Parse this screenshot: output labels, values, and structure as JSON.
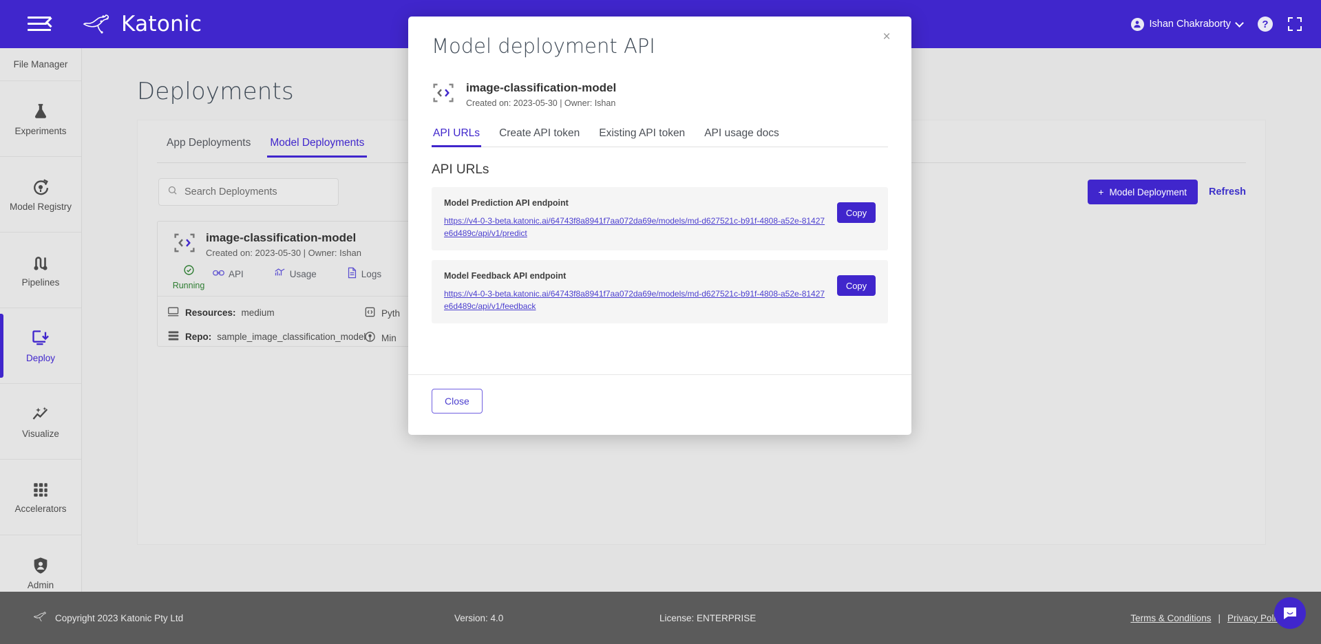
{
  "topbar": {
    "menu_icon": "hamburger-collapse-icon",
    "brand": "Katonic",
    "user_name": "Ishan Chakraborty",
    "help_label": "?",
    "icons": [
      "user-avatar-icon",
      "chevron-down-icon",
      "help-circle-icon",
      "fullscreen-icon"
    ]
  },
  "sidebar": {
    "items": [
      {
        "label": "File Manager",
        "icon": "file-manager-icon",
        "active": false
      },
      {
        "label": "Experiments",
        "icon": "flask-icon",
        "active": false
      },
      {
        "label": "Model Registry",
        "icon": "model-registry-icon",
        "active": false
      },
      {
        "label": "Pipelines",
        "icon": "pipelines-icon",
        "active": false
      },
      {
        "label": "Deploy",
        "icon": "deploy-icon",
        "active": true
      },
      {
        "label": "Visualize",
        "icon": "visualize-sparkle-icon",
        "active": false
      },
      {
        "label": "Accelerators",
        "icon": "grid-dots-icon",
        "active": false
      },
      {
        "label": "Admin",
        "icon": "admin-shield-icon",
        "active": false
      }
    ]
  },
  "main": {
    "page_title": "Deployments",
    "tabs": [
      {
        "label": "App Deployments",
        "active": false
      },
      {
        "label": "Model Deployments",
        "active": true
      }
    ],
    "search": {
      "placeholder": "Search Deployments",
      "value": "",
      "icon": "search-icon"
    },
    "actions": {
      "new_deployment_label": "Model Deployment",
      "new_deployment_plus": "+",
      "refresh_label": "Refresh"
    },
    "card": {
      "title": "image-classification-model",
      "subtitle": "Created on: 2023-05-30 | Owner: Ishan",
      "status": "Running",
      "status_color": "#2e7d32",
      "actions": [
        {
          "label": "API",
          "icon": "link-api-icon"
        },
        {
          "label": "Usage",
          "icon": "usage-chart-icon"
        },
        {
          "label": "Logs",
          "icon": "logs-document-icon"
        }
      ],
      "rows": [
        {
          "key": "Resources:",
          "value": "medium",
          "icon": "monitor-icon"
        },
        {
          "key": "Repo:",
          "value": "sample_image_classification_model",
          "icon": "repo-server-icon"
        }
      ],
      "rows_right": [
        {
          "value": "Pyth",
          "icon": "code-brackets-icon"
        },
        {
          "value": "Min",
          "icon": "broadcast-icon"
        }
      ]
    }
  },
  "modal": {
    "title": "Model deployment API",
    "close_icon": "close-icon",
    "close_glyph": "×",
    "model": {
      "icon": "code-brackets-icon",
      "name": "image-classification-model",
      "meta": "Created on: 2023-05-30 | Owner: Ishan"
    },
    "tabs": [
      {
        "label": "API URLs",
        "active": true
      },
      {
        "label": "Create API token",
        "active": false
      },
      {
        "label": "Existing API token",
        "active": false
      },
      {
        "label": "API usage docs",
        "active": false
      }
    ],
    "section_title": "API URLs",
    "endpoints": [
      {
        "label": "Model Prediction API endpoint",
        "url": "https://v4-0-3-beta.katonic.ai/64743f8a8941f7aa072da69e/models/md-d627521c-b91f-4808-a52e-81427e6d489c/api/v1/predict",
        "copy_label": "Copy"
      },
      {
        "label": "Model Feedback API endpoint",
        "url": "https://v4-0-3-beta.katonic.ai/64743f8a8941f7aa072da69e/models/md-d627521c-b91f-4808-a52e-81427e6d489c/api/v1/feedback",
        "copy_label": "Copy"
      }
    ],
    "close_button_label": "Close"
  },
  "footer": {
    "copyright": "Copyright 2023 Katonic Pty Ltd",
    "version": "Version: 4.0",
    "license": "License: ENTERPRISE",
    "terms": "Terms & Conditions",
    "separator": "|",
    "privacy": "Privacy Policy"
  },
  "chat": {
    "icon": "chat-bubble-icon"
  },
  "colors": {
    "brand_purple": "#4026cc",
    "link_purple": "#4b3ecf",
    "status_green": "#2e7d32",
    "page_bg": "#e2e2e2",
    "footer_bg": "#5b5b5b"
  }
}
